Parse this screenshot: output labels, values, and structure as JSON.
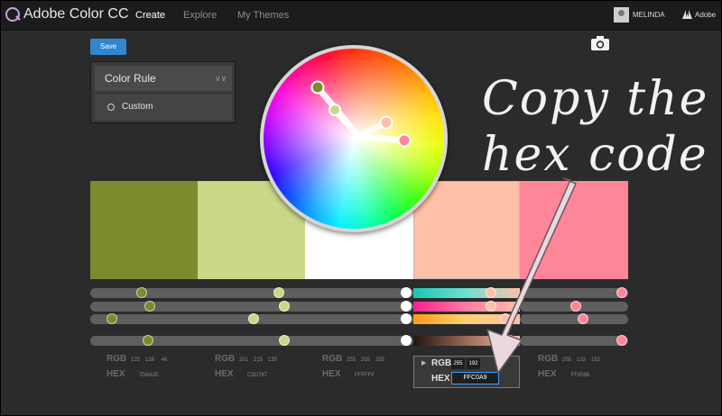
{
  "header": {
    "app_title": "Adobe Color CC",
    "nav": [
      "Create",
      "Explore",
      "My Themes"
    ],
    "username": "MELINDA",
    "brand": "Adobe"
  },
  "toolbar": {
    "save_label": "Save"
  },
  "color_rule": {
    "title": "Color Rule",
    "option": "Custom"
  },
  "annotation": {
    "line1": "Copy the",
    "line2": "hex code"
  },
  "swatches": [
    {
      "hex": "7D8A2E",
      "rgb": [
        "125",
        "138",
        "46"
      ]
    },
    {
      "hex": "C9D787",
      "rgb": [
        "201",
        "215",
        "135"
      ]
    },
    {
      "hex": "FFFFFF",
      "rgb": [
        "255",
        "255",
        "255"
      ]
    },
    {
      "hex": "FFC0A9",
      "rgb": [
        "255",
        "192",
        ""
      ],
      "selected": true
    },
    {
      "hex": "FF8598",
      "rgb": [
        "255",
        "133",
        "152"
      ]
    }
  ],
  "labels": {
    "rgb": "RGB",
    "hex": "HEX"
  },
  "colors": {
    "accent_blue": "#2f87d4",
    "swatch_colors": [
      "#7d8a2e",
      "#c9d787",
      "#ffffff",
      "#ffc0a9",
      "#ff8598"
    ]
  }
}
